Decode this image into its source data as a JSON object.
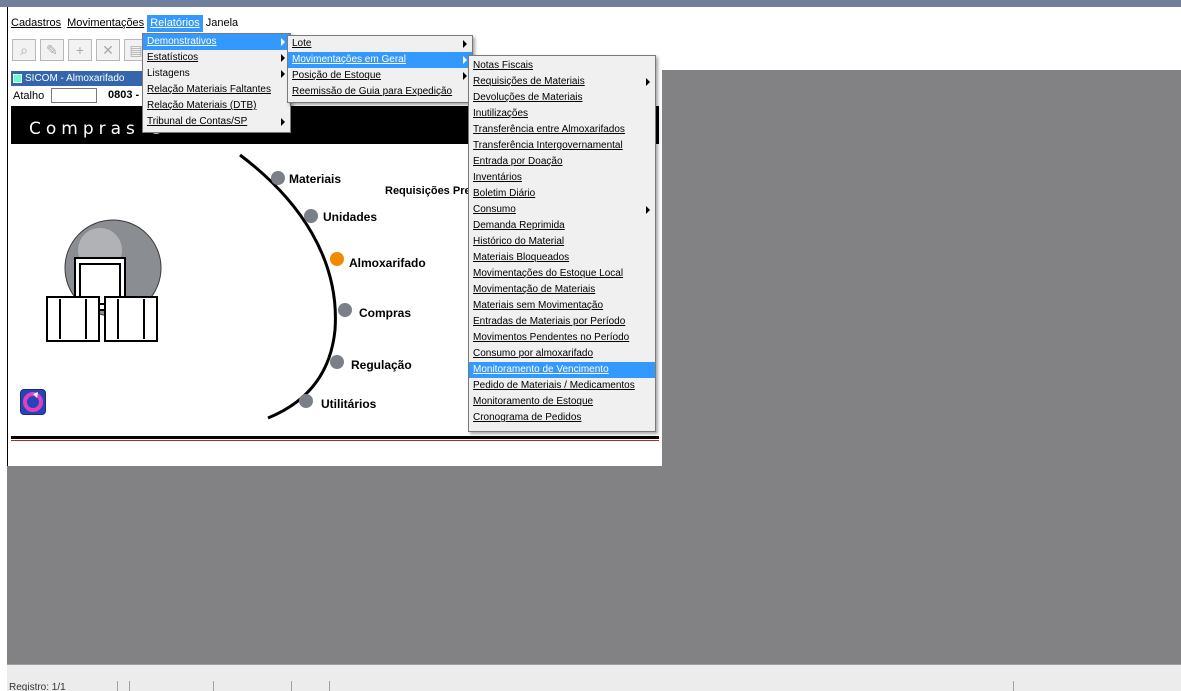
{
  "menubar": {
    "items": [
      "Cadastros",
      "Movimentações",
      "Relatórios",
      "Janela"
    ],
    "active": "Relatórios"
  },
  "subwindow": {
    "title": "SICOM - Almoxarifado",
    "atalho_label": "Atalho",
    "code": "0803 -"
  },
  "banner": {
    "title": "Compras e"
  },
  "nav": {
    "materiais": "Materiais",
    "unidades": "Unidades",
    "almoxarifado": "Almoxarifado",
    "compras": "Compras",
    "regulacao": "Regulação",
    "utilitarios": "Utilitários",
    "requisicoes": "Requisições Pre"
  },
  "menu_relatorios": {
    "items": [
      "Demonstrativos",
      "Estatísticos",
      "Listagens",
      "Relação Materiais Faltantes",
      "Relação Materiais (DTB)",
      "Tribunal de Contas/SP"
    ]
  },
  "menu_demonstrativos": {
    "items": [
      "Lote",
      "Movimentações em Geral",
      "Posição de Estoque",
      "Reemissão de Guia para Expedição"
    ]
  },
  "menu_movimentacoes": {
    "items": [
      "Notas Fiscais",
      "Requisições de Materiais",
      "Devoluções de Materiais",
      "Inutilizações",
      "Transferência entre Almoxarifados",
      "Transferência Intergovernamental",
      "Entrada por Doação",
      "Inventários",
      "Boletim Diário",
      "Consumo",
      "Demanda Reprimida",
      "Histórico do Material",
      "Materiais Bloqueados",
      "Movimentações do Estoque Local",
      "Movimentação de Materiais",
      "Materiais sem Movimentação",
      "Entradas de Materiais por Período",
      "Movimentos Pendentes no Período",
      "Consumo por almoxarifado",
      "Monitoramento de Vencimento",
      "Pedido de Materiais / Medicamentos",
      "Monitoramento de Estoque",
      "Cronograma de Pedidos"
    ]
  },
  "status": {
    "registro": "Registro: 1/1"
  },
  "colors": {
    "highlight": "#3399ff",
    "banner": "#000000",
    "mdi_background": "#828183",
    "almox_dot": "#f28a00"
  }
}
